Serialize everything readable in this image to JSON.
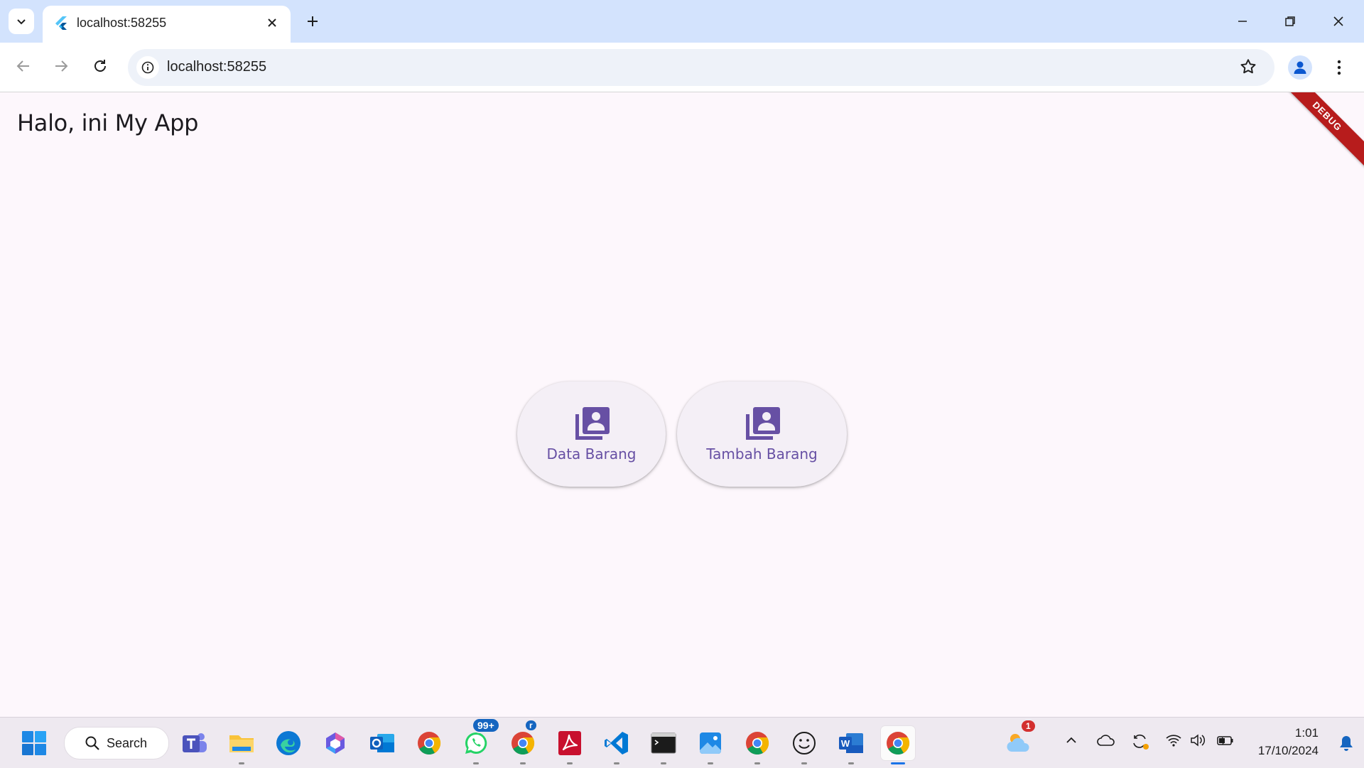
{
  "browser": {
    "tab_title": "localhost:58255",
    "url": "localhost:58255"
  },
  "page": {
    "title": "Halo, ini My App",
    "debug_banner": "DEBUG",
    "buttons": [
      {
        "label": "Data Barang",
        "icon": "contacts-book-icon"
      },
      {
        "label": "Tambah Barang",
        "icon": "contacts-book-icon"
      }
    ]
  },
  "taskbar": {
    "search_label": "Search",
    "whatsapp_badge": "99+",
    "chrome_profile_badge": "r",
    "weather_badge": "1",
    "time": "1:01",
    "date": "17/10/2024"
  },
  "colors": {
    "accent": "#6750a4",
    "page_bg": "#fdf7fc",
    "button_bg": "#f4eff6",
    "titlebar_bg": "#d3e3fd",
    "debug_red": "#b71c1c"
  }
}
